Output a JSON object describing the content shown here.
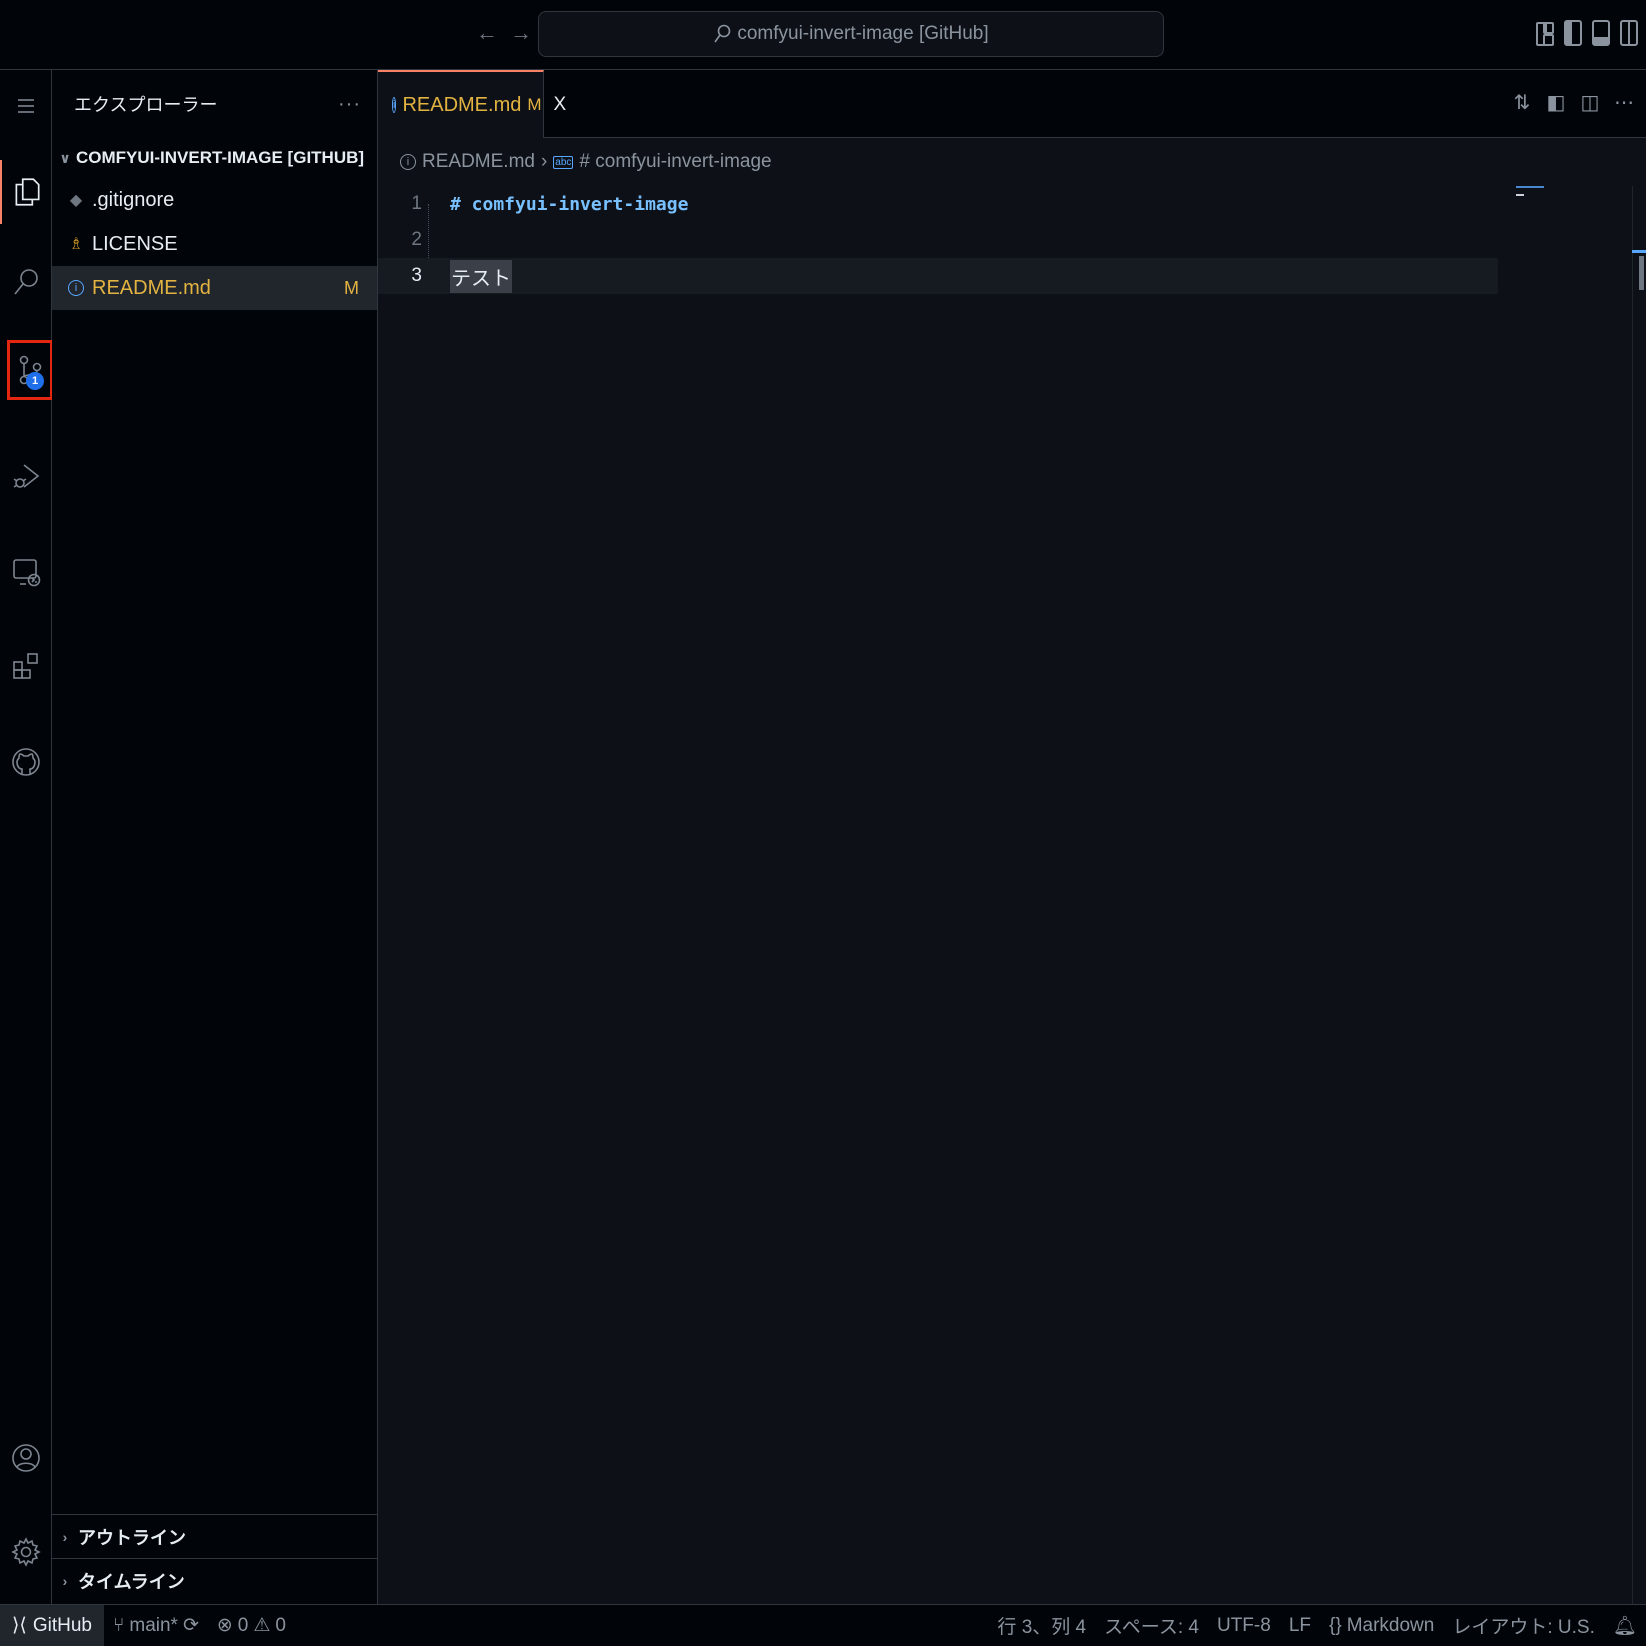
{
  "titlebar": {
    "back_icon": "arrow-left-icon",
    "forward_icon": "arrow-right-icon",
    "search_text": "comfyui-invert-image [GitHub]"
  },
  "activitybar": {
    "items": [
      "explorer-icon",
      "search-icon",
      "source-control-icon",
      "run-debug-icon",
      "remote-explorer-icon",
      "extensions-icon",
      "github-icon"
    ],
    "source_control_badge": "1",
    "bottom": [
      "account-icon",
      "settings-gear-icon"
    ]
  },
  "sidebar": {
    "title": "エクスプローラー",
    "more": "···",
    "folder": "COMFYUI-INVERT-IMAGE [GITHUB]",
    "files": [
      {
        "name": ".gitignore",
        "status": ""
      },
      {
        "name": "LICENSE",
        "status": ""
      },
      {
        "name": "README.md",
        "status": "M"
      }
    ],
    "outline": "アウトライン",
    "timeline": "タイムライン"
  },
  "editor": {
    "tab": {
      "label": "README.md",
      "status": "M",
      "close": "X"
    },
    "breadcrumb": {
      "file": "README.md",
      "symbol": "# comfyui-invert-image"
    },
    "lines": [
      {
        "num": "1",
        "text": "# comfyui-invert-image"
      },
      {
        "num": "2",
        "text": ""
      },
      {
        "num": "3",
        "text": "テスト"
      }
    ]
  },
  "statusbar": {
    "remote": "GitHub",
    "branch": "main*",
    "errors": "0",
    "warnings": "0",
    "position": "行 3、列 4",
    "spaces": "スペース: 4",
    "encoding": "UTF-8",
    "eol": "LF",
    "language": "Markdown",
    "layout": "レイアウト: U.S."
  },
  "colors": {
    "accent": "#f78166",
    "modified": "#e3b341",
    "heading": "#79c0ff",
    "badge": "#1f6feb",
    "highlight_box": "#e3260f"
  }
}
